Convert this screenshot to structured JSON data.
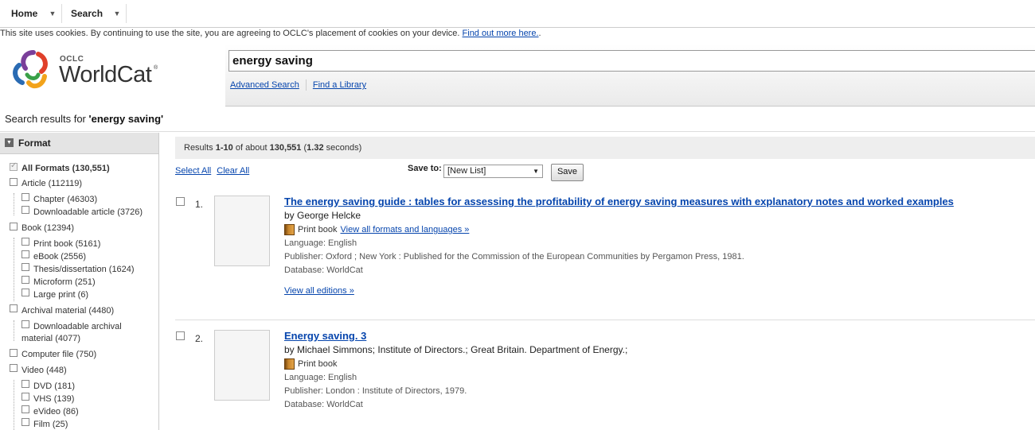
{
  "nav": {
    "home": "Home",
    "search": "Search"
  },
  "cookie": {
    "text": "This site uses cookies. By continuing to use the site, you are agreeing to OCLC's placement of cookies on your device. ",
    "link": "Find out more here.",
    "end": "."
  },
  "logo": {
    "oclc": "OCLC",
    "name": "WorldCat",
    "reg": "®"
  },
  "search": {
    "query": "energy saving",
    "advanced": "Advanced Search",
    "find_library": "Find a Library"
  },
  "results_heading": {
    "prefix": "Search results for ",
    "query": "'energy saving'"
  },
  "facets": {
    "title": "Format",
    "items": [
      {
        "label": "All Formats",
        "count": "(130,551)",
        "bold": true
      },
      {
        "label": "Article",
        "count": "(112119)"
      },
      {
        "label": "Chapter",
        "count": "(46303)"
      },
      {
        "label": "Downloadable article",
        "count": "(3726)"
      },
      {
        "label": "Book",
        "count": "(12394)"
      },
      {
        "label": "Print book",
        "count": "(5161)"
      },
      {
        "label": "eBook",
        "count": "(2556)"
      },
      {
        "label": "Thesis/dissertation",
        "count": "(1624)"
      },
      {
        "label": "Microform",
        "count": "(251)"
      },
      {
        "label": "Large print",
        "count": "(6)"
      },
      {
        "label": "Archival material",
        "count": "(4480)"
      },
      {
        "label": "Downloadable archival",
        "line2": "material",
        "count": "(4077)"
      },
      {
        "label": "Computer file",
        "count": "(750)"
      },
      {
        "label": "Video",
        "count": "(448)"
      },
      {
        "label": "DVD",
        "count": "(181)"
      },
      {
        "label": "VHS",
        "count": "(139)"
      },
      {
        "label": "eVideo",
        "count": "(86)"
      },
      {
        "label": "Film",
        "count": "(25)"
      }
    ]
  },
  "results_bar": {
    "p1": "Results ",
    "range": "1-10",
    "p2": " of about ",
    "total": "130,551",
    "p3": " (",
    "time": "1.32",
    "p4": " seconds)"
  },
  "actions": {
    "select_all": "Select All",
    "clear_all": "Clear All",
    "save_to": "Save to:",
    "list_value": "[New List]",
    "save": "Save"
  },
  "records": [
    {
      "num": "1.",
      "title": "The energy saving guide : tables for assessing the profitability of energy saving measures with explanatory notes and worked examples",
      "by": "by George Helcke",
      "format": "Print book",
      "all_formats": "View all formats and languages »",
      "language": "Language: English",
      "publisher": "Publisher: Oxford ; New York : Published for the Commission of the European Communities by Pergamon Press, 1981.",
      "database": "Database: WorldCat",
      "editions": "View all editions »"
    },
    {
      "num": "2.",
      "title": "Energy saving. 3",
      "by": "by Michael Simmons; Institute of Directors.; Great Britain. Department of Energy.;",
      "format": "Print book",
      "language": "Language: English",
      "publisher": "Publisher: London : Institute of Directors, 1979.",
      "database": "Database: WorldCat"
    }
  ]
}
